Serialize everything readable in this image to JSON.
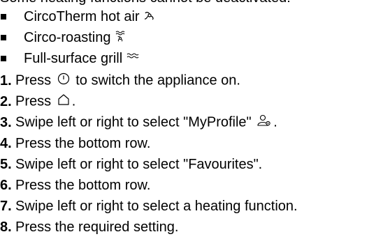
{
  "intro_text": "Some heating functions cannot be deactivated:",
  "bullets": [
    {
      "label": "CircoTherm hot air",
      "icon": "circotherm-icon"
    },
    {
      "label": "Circo-roasting",
      "icon": "circo-roasting-icon"
    },
    {
      "label": "Full-surface grill",
      "icon": "full-surface-grill-icon"
    }
  ],
  "steps": [
    {
      "num": "1.",
      "before": "Press",
      "icon": "power-icon",
      "after": "to switch the appliance on."
    },
    {
      "num": "2.",
      "before": "Press",
      "icon": "home-icon",
      "after": "."
    },
    {
      "num": "3.",
      "before": "Swipe left or right to select \"MyProfile\"",
      "icon": "profile-icon",
      "after": "."
    },
    {
      "num": "4.",
      "before": "Press the bottom row.",
      "icon": "",
      "after": ""
    },
    {
      "num": "5.",
      "before": "Swipe left or right to select \"Favourites\".",
      "icon": "",
      "after": ""
    },
    {
      "num": "6.",
      "before": "Press the bottom row.",
      "icon": "",
      "after": ""
    },
    {
      "num": "7.",
      "before": "Swipe left or right to select a heating function.",
      "icon": "",
      "after": ""
    },
    {
      "num": "8.",
      "before": "Press the required setting.",
      "icon": "",
      "after": ""
    }
  ]
}
